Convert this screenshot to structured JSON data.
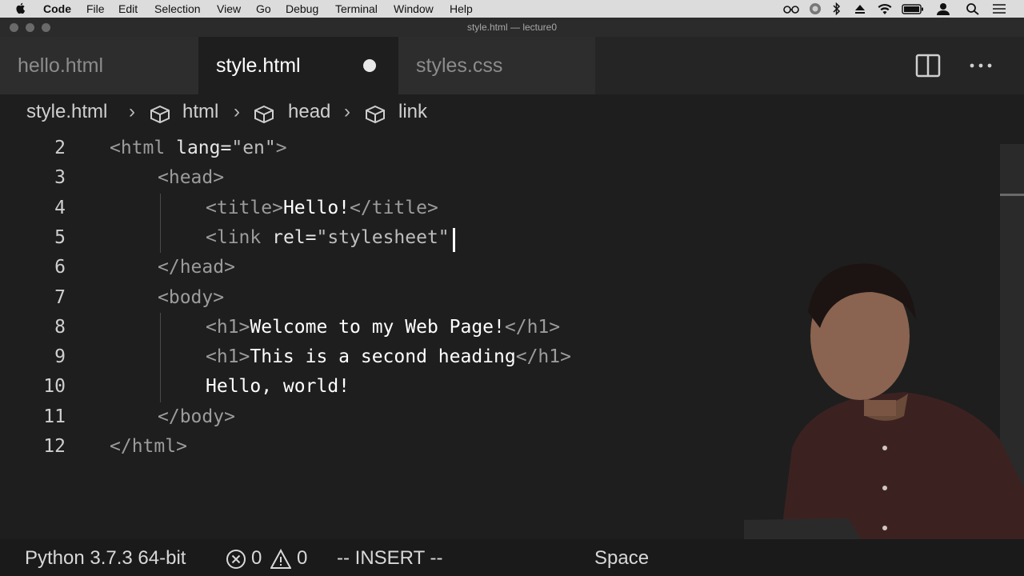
{
  "menubar": {
    "app_name": "Code",
    "items": [
      "File",
      "Edit",
      "Selection",
      "View",
      "Go",
      "Debug",
      "Terminal",
      "Window",
      "Help"
    ]
  },
  "window": {
    "title": "style.html — lecture0"
  },
  "tabs": [
    {
      "label": "hello.html",
      "active": false,
      "dirty": false
    },
    {
      "label": "style.html",
      "active": true,
      "dirty": true
    },
    {
      "label": "styles.css",
      "active": false,
      "dirty": false
    }
  ],
  "breadcrumb": [
    "style.html",
    "html",
    "head",
    "link"
  ],
  "editor": {
    "lines": [
      {
        "number": "2",
        "indent": 0,
        "segments": [
          [
            "tag",
            "<html "
          ],
          [
            "attr",
            "lang="
          ],
          [
            "str",
            "\"en\""
          ],
          [
            "tag",
            ">"
          ]
        ]
      },
      {
        "number": "3",
        "indent": 1,
        "segments": [
          [
            "tag",
            "<head>"
          ]
        ]
      },
      {
        "number": "4",
        "indent": 2,
        "segments": [
          [
            "tag",
            "<title>"
          ],
          [
            "txt",
            "Hello!"
          ],
          [
            "tag",
            "</title>"
          ]
        ]
      },
      {
        "number": "5",
        "indent": 2,
        "segments": [
          [
            "tag",
            "<link "
          ],
          [
            "attr",
            "rel="
          ],
          [
            "str",
            "\"stylesheet\""
          ]
        ]
      },
      {
        "number": "6",
        "indent": 1,
        "segments": [
          [
            "tag",
            "</head>"
          ]
        ]
      },
      {
        "number": "7",
        "indent": 1,
        "segments": [
          [
            "tag",
            "<body>"
          ]
        ]
      },
      {
        "number": "8",
        "indent": 2,
        "segments": [
          [
            "tag",
            "<h1>"
          ],
          [
            "txt",
            "Welcome to my Web Page!"
          ],
          [
            "tag",
            "</h1>"
          ]
        ]
      },
      {
        "number": "9",
        "indent": 2,
        "segments": [
          [
            "tag",
            "<h1>"
          ],
          [
            "txt",
            "This is a second heading"
          ],
          [
            "tag",
            "</h1>"
          ]
        ]
      },
      {
        "number": "10",
        "indent": 2,
        "segments": [
          [
            "txt",
            "Hello, world!"
          ]
        ]
      },
      {
        "number": "11",
        "indent": 1,
        "segments": [
          [
            "tag",
            "</body>"
          ]
        ]
      },
      {
        "number": "12",
        "indent": 0,
        "segments": [
          [
            "tag",
            "</html>"
          ]
        ]
      }
    ],
    "cursor_line": "5"
  },
  "statusbar": {
    "python": "Python 3.7.3 64-bit",
    "errors": "0",
    "warnings": "0",
    "mode": "-- INSERT --",
    "spaces": "Space"
  },
  "icons": {
    "menubar_tray": [
      "glasses-icon",
      "app-badge-icon",
      "bluetooth-icon",
      "eject-icon",
      "wifi-icon",
      "battery-icon",
      "user-icon",
      "search-icon",
      "list-icon"
    ],
    "toolbar": [
      "split-editor-icon",
      "more-actions-icon"
    ],
    "breadcrumb": "symbol-cube-icon",
    "status": [
      "error-icon",
      "warning-icon"
    ]
  },
  "colors": {
    "tab_active": "#1e1e1e",
    "tab_inactive": "#2d2d2d",
    "editor_bg": "#1e1e1e"
  }
}
